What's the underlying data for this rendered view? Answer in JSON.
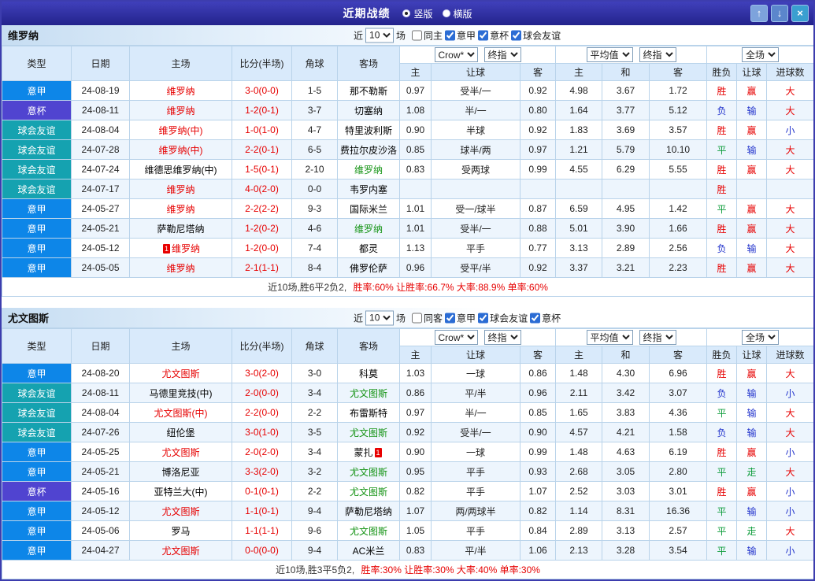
{
  "title_bar": {
    "title": "近期战绩",
    "radio_vertical": "竖版",
    "radio_horizontal": "横版",
    "up_icon": "↑",
    "down_icon": "↓",
    "close_icon": "×"
  },
  "controls": {
    "near": "近",
    "games": "10",
    "unit": "场",
    "asia_primary": "Crow*",
    "asia_final": "终指",
    "euro_avg": "平均值",
    "euro_final": "终指",
    "scope": "全场"
  },
  "columns": [
    "类型",
    "日期",
    "主场",
    "比分(半场)",
    "角球",
    "客场",
    "主",
    "让球",
    "客",
    "主",
    "和",
    "客",
    "胜负",
    "让球",
    "进球数"
  ],
  "colors": {
    "score": "#e60000",
    "type_bg": {
      "意甲": "#0d86e8",
      "意杯": "#5044d0",
      "球会友谊": "#15a2b0"
    },
    "team": {
      "red": "#e60000",
      "green": "#149314",
      "black": "#000000"
    },
    "mark": {
      "胜": "#e60000",
      "负": "#2233cc",
      "平": "#0f9d3c",
      "赢": "#e60000",
      "输": "#2233cc",
      "走": "#0f9d3c",
      "大": "#e60000",
      "小": "#2233cc"
    }
  },
  "sections": [
    {
      "team": "维罗纳",
      "filters": {
        "same_label": "同主",
        "leagues": [
          {
            "label": "意甲",
            "checked": true
          },
          {
            "label": "意杯",
            "checked": true
          },
          {
            "label": "球会友谊",
            "checked": true
          }
        ]
      },
      "rows": [
        {
          "type": "意甲",
          "date": "24-08-19",
          "home": "维罗纳",
          "home_c": "red",
          "score": "3-0(0-0)",
          "corner": "1-5",
          "away": "那不勒斯",
          "a1": "0.97",
          "a2": "受半/一",
          "a3": "0.92",
          "e1": "4.98",
          "e2": "3.67",
          "e3": "1.72",
          "r1": "胜",
          "r2": "赢",
          "r3": "大"
        },
        {
          "type": "意杯",
          "date": "24-08-11",
          "home": "维罗纳",
          "home_c": "red",
          "score": "1-2(0-1)",
          "corner": "3-7",
          "away": "切塞纳",
          "a1": "1.08",
          "a2": "半/一",
          "a3": "0.80",
          "e1": "1.64",
          "e2": "3.77",
          "e3": "5.12",
          "r1": "负",
          "r2": "输",
          "r3": "大"
        },
        {
          "type": "球会友谊",
          "date": "24-08-04",
          "home": "维罗纳(中)",
          "home_c": "red",
          "score": "1-0(1-0)",
          "corner": "4-7",
          "away": "特里波利斯",
          "a1": "0.90",
          "a2": "半球",
          "a3": "0.92",
          "e1": "1.83",
          "e2": "3.69",
          "e3": "3.57",
          "r1": "胜",
          "r2": "赢",
          "r3": "小"
        },
        {
          "type": "球会友谊",
          "date": "24-07-28",
          "home": "维罗纳(中)",
          "home_c": "red",
          "score": "2-2(0-1)",
          "corner": "6-5",
          "away": "费拉尔皮沙洛",
          "a1": "0.85",
          "a2": "球半/两",
          "a3": "0.97",
          "e1": "1.21",
          "e2": "5.79",
          "e3": "10.10",
          "r1": "平",
          "r2": "输",
          "r3": "大"
        },
        {
          "type": "球会友谊",
          "date": "24-07-24",
          "home": "维德思维罗纳(中)",
          "score": "1-5(0-1)",
          "corner": "2-10",
          "away": "维罗纳",
          "away_c": "green",
          "a1": "0.83",
          "a2": "受两球",
          "a3": "0.99",
          "e1": "4.55",
          "e2": "6.29",
          "e3": "5.55",
          "r1": "胜",
          "r2": "赢",
          "r3": "大"
        },
        {
          "type": "球会友谊",
          "date": "24-07-17",
          "home": "维罗纳",
          "home_c": "red",
          "score": "4-0(2-0)",
          "corner": "0-0",
          "away": "韦罗内塞",
          "a1": "",
          "a2": "",
          "a3": "",
          "e1": "",
          "e2": "",
          "e3": "",
          "r1": "胜",
          "r2": "",
          "r3": ""
        },
        {
          "type": "意甲",
          "date": "24-05-27",
          "home": "维罗纳",
          "home_c": "red",
          "score": "2-2(2-2)",
          "corner": "9-3",
          "away": "国际米兰",
          "a1": "1.01",
          "a2": "受一/球半",
          "a3": "0.87",
          "e1": "6.59",
          "e2": "4.95",
          "e3": "1.42",
          "r1": "平",
          "r2": "赢",
          "r3": "大"
        },
        {
          "type": "意甲",
          "date": "24-05-21",
          "home": "萨勒尼塔纳",
          "score": "1-2(0-2)",
          "corner": "4-6",
          "away": "维罗纳",
          "away_c": "green",
          "a1": "1.01",
          "a2": "受半/一",
          "a3": "0.88",
          "e1": "5.01",
          "e2": "3.90",
          "e3": "1.66",
          "r1": "胜",
          "r2": "赢",
          "r3": "大"
        },
        {
          "type": "意甲",
          "date": "24-05-12",
          "home": "维罗纳",
          "home_c": "red",
          "home_badge": "1",
          "score": "1-2(0-0)",
          "corner": "7-4",
          "away": "都灵",
          "a1": "1.13",
          "a2": "平手",
          "a3": "0.77",
          "e1": "3.13",
          "e2": "2.89",
          "e3": "2.56",
          "r1": "负",
          "r2": "输",
          "r3": "大"
        },
        {
          "type": "意甲",
          "date": "24-05-05",
          "home": "维罗纳",
          "home_c": "red",
          "score": "2-1(1-1)",
          "corner": "8-4",
          "away": "佛罗伦萨",
          "a1": "0.96",
          "a2": "受平/半",
          "a3": "0.92",
          "e1": "3.37",
          "e2": "3.21",
          "e3": "2.23",
          "r1": "胜",
          "r2": "赢",
          "r3": "大"
        }
      ],
      "summary": {
        "prefix": "近10场,胜6平2负2,",
        "stats": "胜率:60% 让胜率:66.7% 大率:88.9% 单率:60%"
      }
    },
    {
      "team": "尤文图斯",
      "filters": {
        "same_label": "同客",
        "leagues": [
          {
            "label": "意甲",
            "checked": true
          },
          {
            "label": "球会友谊",
            "checked": true
          },
          {
            "label": "意杯",
            "checked": true
          }
        ]
      },
      "rows": [
        {
          "type": "意甲",
          "date": "24-08-20",
          "home": "尤文图斯",
          "home_c": "red",
          "score": "3-0(2-0)",
          "corner": "3-0",
          "away": "科莫",
          "a1": "1.03",
          "a2": "一球",
          "a3": "0.86",
          "e1": "1.48",
          "e2": "4.30",
          "e3": "6.96",
          "r1": "胜",
          "r2": "赢",
          "r3": "大"
        },
        {
          "type": "球会友谊",
          "date": "24-08-11",
          "home": "马德里竞技(中)",
          "score": "2-0(0-0)",
          "corner": "3-4",
          "away": "尤文图斯",
          "away_c": "green",
          "a1": "0.86",
          "a2": "平/半",
          "a3": "0.96",
          "e1": "2.11",
          "e2": "3.42",
          "e3": "3.07",
          "r1": "负",
          "r2": "输",
          "r3": "小"
        },
        {
          "type": "球会友谊",
          "date": "24-08-04",
          "home": "尤文图斯(中)",
          "home_c": "red",
          "score": "2-2(0-0)",
          "corner": "2-2",
          "away": "布雷斯特",
          "a1": "0.97",
          "a2": "半/一",
          "a3": "0.85",
          "e1": "1.65",
          "e2": "3.83",
          "e3": "4.36",
          "r1": "平",
          "r2": "输",
          "r3": "大"
        },
        {
          "type": "球会友谊",
          "date": "24-07-26",
          "home": "纽伦堡",
          "score": "3-0(1-0)",
          "corner": "3-5",
          "away": "尤文图斯",
          "away_c": "green",
          "a1": "0.92",
          "a2": "受半/一",
          "a3": "0.90",
          "e1": "4.57",
          "e2": "4.21",
          "e3": "1.58",
          "r1": "负",
          "r2": "输",
          "r3": "大"
        },
        {
          "type": "意甲",
          "date": "24-05-25",
          "home": "尤文图斯",
          "home_c": "red",
          "score": "2-0(2-0)",
          "corner": "3-4",
          "away": "蒙扎",
          "away_badge": "1",
          "a1": "0.90",
          "a2": "一球",
          "a3": "0.99",
          "e1": "1.48",
          "e2": "4.63",
          "e3": "6.19",
          "r1": "胜",
          "r2": "赢",
          "r3": "小"
        },
        {
          "type": "意甲",
          "date": "24-05-21",
          "home": "博洛尼亚",
          "score": "3-3(2-0)",
          "corner": "3-2",
          "away": "尤文图斯",
          "away_c": "green",
          "a1": "0.95",
          "a2": "平手",
          "a3": "0.93",
          "e1": "2.68",
          "e2": "3.05",
          "e3": "2.80",
          "r1": "平",
          "r2": "走",
          "r3": "大"
        },
        {
          "type": "意杯",
          "date": "24-05-16",
          "home": "亚特兰大(中)",
          "score": "0-1(0-1)",
          "corner": "2-2",
          "away": "尤文图斯",
          "away_c": "green",
          "a1": "0.82",
          "a2": "平手",
          "a3": "1.07",
          "e1": "2.52",
          "e2": "3.03",
          "e3": "3.01",
          "r1": "胜",
          "r2": "赢",
          "r3": "小"
        },
        {
          "type": "意甲",
          "date": "24-05-12",
          "home": "尤文图斯",
          "home_c": "red",
          "score": "1-1(0-1)",
          "corner": "9-4",
          "away": "萨勒尼塔纳",
          "a1": "1.07",
          "a2": "两/两球半",
          "a3": "0.82",
          "e1": "1.14",
          "e2": "8.31",
          "e3": "16.36",
          "r1": "平",
          "r2": "输",
          "r3": "小"
        },
        {
          "type": "意甲",
          "date": "24-05-06",
          "home": "罗马",
          "score": "1-1(1-1)",
          "corner": "9-6",
          "away": "尤文图斯",
          "away_c": "green",
          "a1": "1.05",
          "a2": "平手",
          "a3": "0.84",
          "e1": "2.89",
          "e2": "3.13",
          "e3": "2.57",
          "r1": "平",
          "r2": "走",
          "r3": "大"
        },
        {
          "type": "意甲",
          "date": "24-04-27",
          "home": "尤文图斯",
          "home_c": "red",
          "score": "0-0(0-0)",
          "corner": "9-4",
          "away": "AC米兰",
          "a1": "0.83",
          "a2": "平/半",
          "a3": "1.06",
          "e1": "2.13",
          "e2": "3.28",
          "e3": "3.54",
          "r1": "平",
          "r2": "输",
          "r3": "小"
        }
      ],
      "summary": {
        "prefix": "近10场,胜3平5负2,",
        "stats": "胜率:30% 让胜率:30% 大率:40% 单率:30%"
      }
    }
  ]
}
